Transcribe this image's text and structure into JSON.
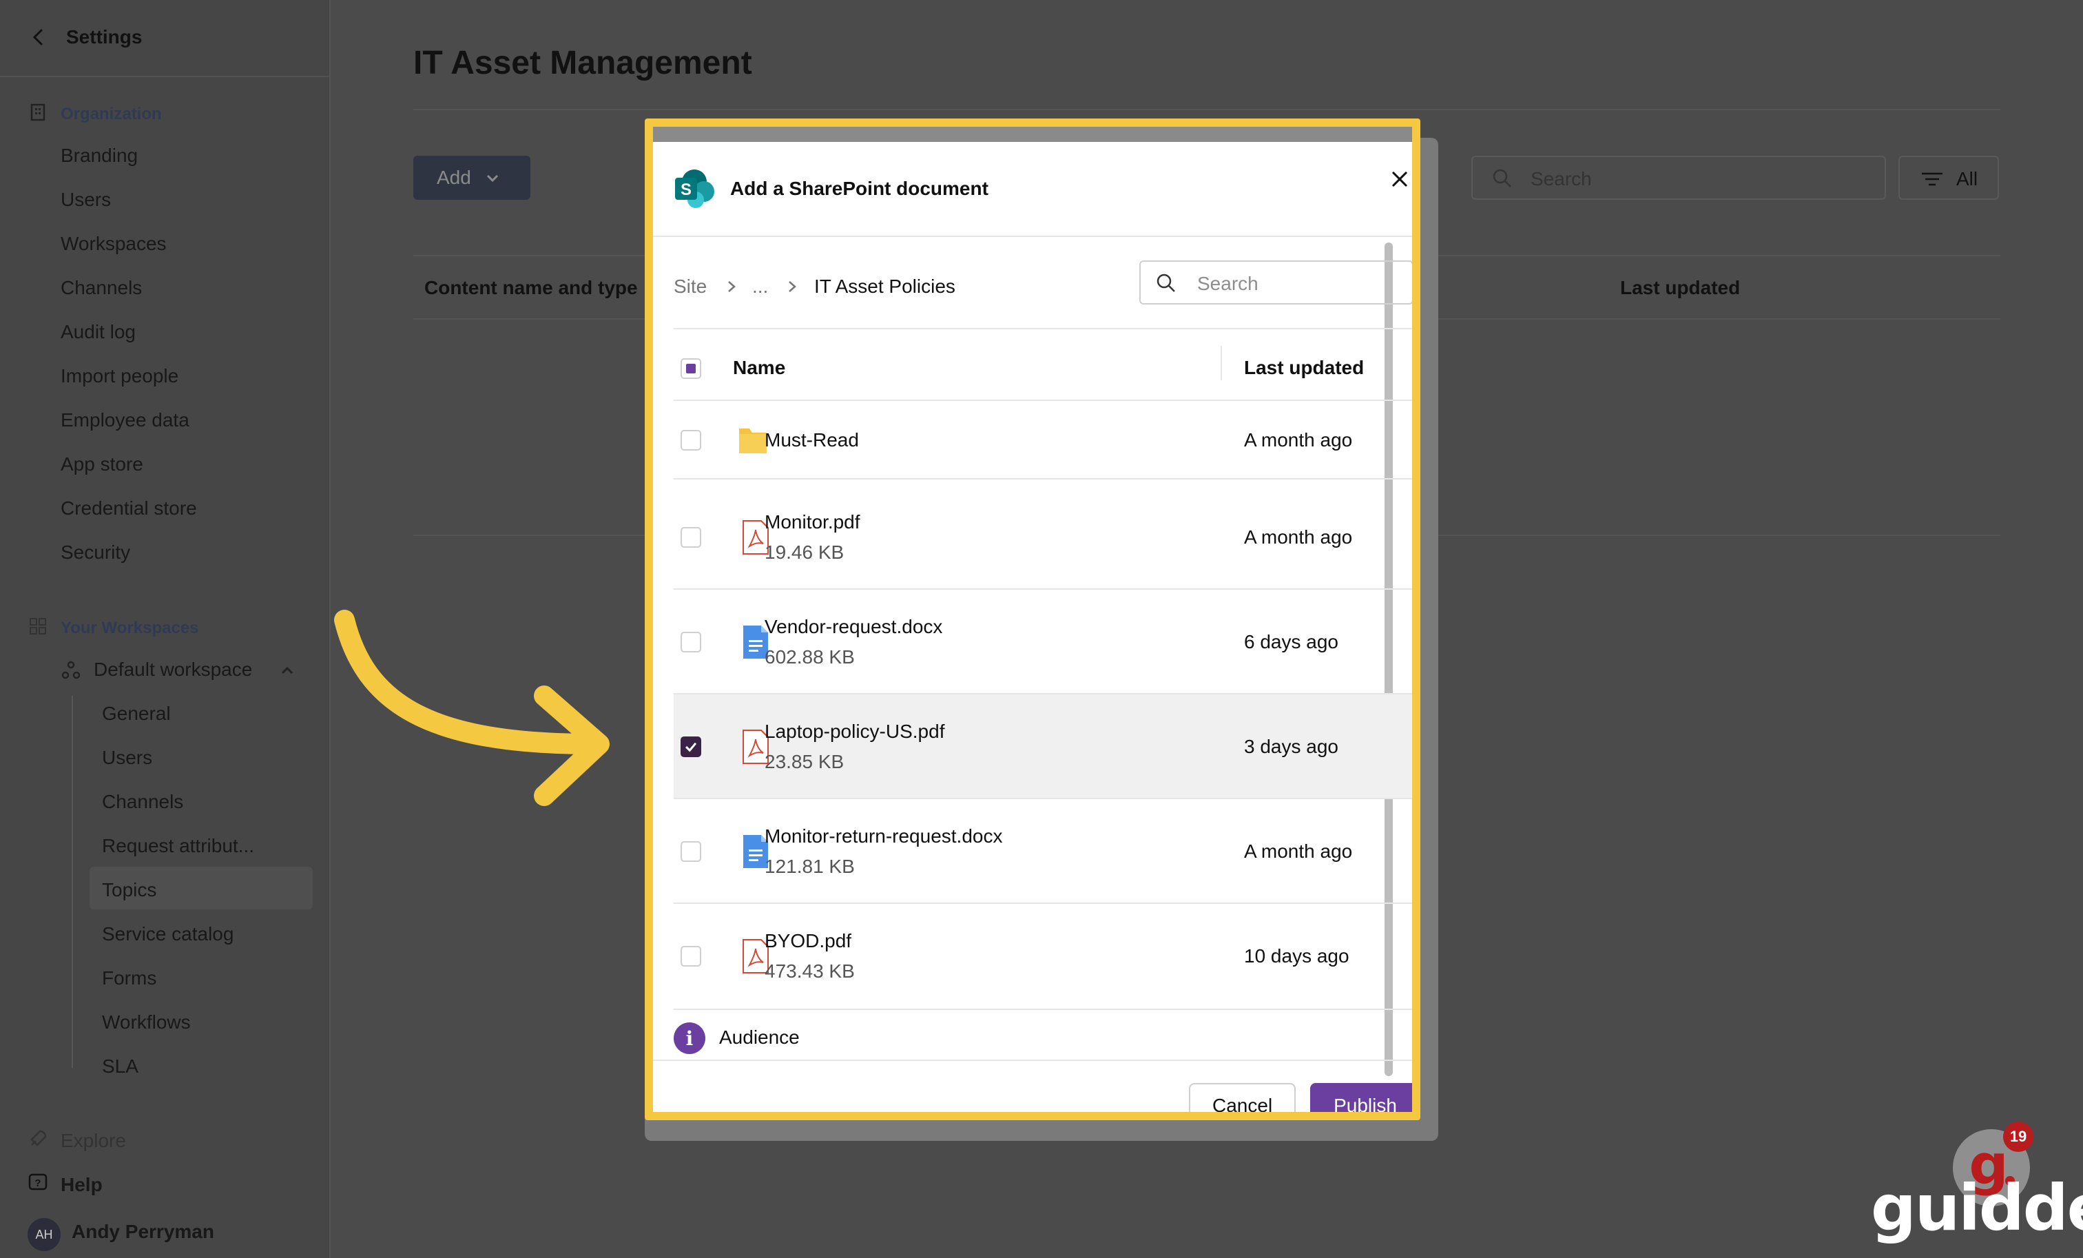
{
  "sidebar": {
    "title": "Settings",
    "organization_label": "Organization",
    "org_items": [
      "Branding",
      "Users",
      "Workspaces",
      "Channels",
      "Audit log",
      "Import people",
      "Employee data",
      "App store",
      "Credential store",
      "Security"
    ],
    "workspaces_label": "Your Workspaces",
    "workspace_name": "Default workspace",
    "workspace_items": [
      "General",
      "Users",
      "Channels",
      "Request attribut...",
      "Topics",
      "Service catalog",
      "Forms",
      "Workflows",
      "SLA"
    ],
    "selected_item": "Topics",
    "explore": "Explore",
    "help": "Help",
    "user_initials": "AH",
    "user_name": "Andy Perryman"
  },
  "main": {
    "title": "IT Asset Management",
    "add_label": "Add",
    "search_placeholder": "Search",
    "filter_label": "All",
    "columns": [
      "Content name and type",
      "Last updated"
    ]
  },
  "modal": {
    "title": "Add a SharePoint document",
    "breadcrumb": [
      "Site",
      "...",
      "IT Asset Policies"
    ],
    "search_placeholder": "Search",
    "col_name": "Name",
    "col_updated": "Last updated",
    "files": [
      {
        "name": "Must-Read",
        "size": "",
        "updated": "A month ago",
        "type": "folder",
        "checked": false
      },
      {
        "name": "Monitor.pdf",
        "size": "19.46 KB",
        "updated": "A month ago",
        "type": "pdf",
        "checked": false
      },
      {
        "name": "Vendor-request.docx",
        "size": "602.88 KB",
        "updated": "6 days ago",
        "type": "doc",
        "checked": false
      },
      {
        "name": "Laptop-policy-US.pdf",
        "size": "23.85 KB",
        "updated": "3 days ago",
        "type": "pdf",
        "checked": true
      },
      {
        "name": "Monitor-return-request.docx",
        "size": "121.81 KB",
        "updated": "A month ago",
        "type": "doc",
        "checked": false
      },
      {
        "name": "BYOD.pdf",
        "size": "473.43 KB",
        "updated": "10 days ago",
        "type": "pdf",
        "checked": false
      }
    ],
    "audience_label": "Audience",
    "cancel_label": "Cancel",
    "publish_label": "Publish"
  },
  "watermark": {
    "text": "guidde.",
    "badge": "19"
  },
  "colors": {
    "highlight_border": "#f5c842",
    "primary": "#6b3fa0",
    "arrow": "#f5c842"
  }
}
